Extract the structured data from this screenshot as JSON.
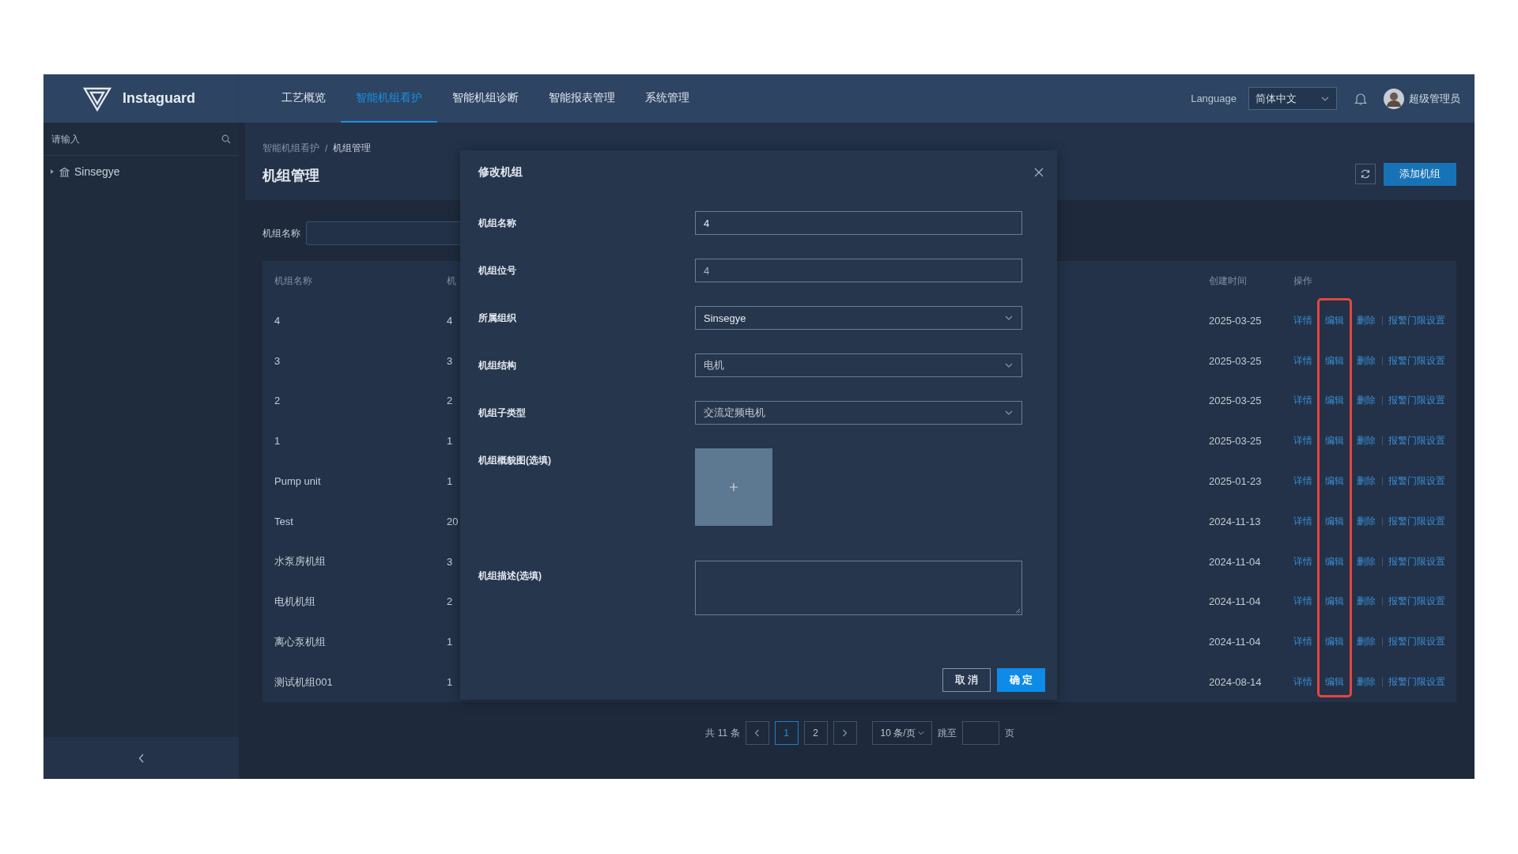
{
  "header": {
    "logo": "Instaguard",
    "nav": [
      {
        "label": "工艺概览",
        "selected": false
      },
      {
        "label": "智能机组看护",
        "selected": true
      },
      {
        "label": "智能机组诊断",
        "selected": false
      },
      {
        "label": "智能报表管理",
        "selected": false
      },
      {
        "label": "系统管理",
        "selected": false
      }
    ],
    "language_label": "Language",
    "language": "简体中文",
    "user": "超级管理员"
  },
  "sidebar": {
    "search_placeholder": "请输入",
    "tree": [
      {
        "label": "Sinsegye",
        "expanded": false
      }
    ]
  },
  "breadcrumb": [
    "智能机组看护",
    "机组管理"
  ],
  "breadcrumb_separator": "/",
  "page_title": "机组管理",
  "add_button": "添加机组",
  "filter": {
    "label": "机组名称"
  },
  "table": {
    "columns": [
      "机组名称",
      "机",
      "创建时间",
      "操作"
    ],
    "action_columns": [
      {
        "highlighted": false
      },
      {
        "highlighted": true
      },
      {
        "highlighted": false
      },
      {
        "highlighted": false
      }
    ],
    "rows": [
      {
        "cells": [
          "4",
          "4",
          "2025-03-25"
        ],
        "actions": [
          "详情",
          "编辑",
          "删除",
          "报警门限设置"
        ]
      },
      {
        "cells": [
          "3",
          "3",
          "2025-03-25"
        ],
        "actions": [
          "详情",
          "编辑",
          "删除",
          "报警门限设置"
        ]
      },
      {
        "cells": [
          "2",
          "2",
          "2025-03-25"
        ],
        "actions": [
          "详情",
          "编辑",
          "删除",
          "报警门限设置"
        ]
      },
      {
        "cells": [
          "1",
          "1",
          "2025-03-25"
        ],
        "actions": [
          "详情",
          "编辑",
          "删除",
          "报警门限设置"
        ]
      },
      {
        "cells": [
          "Pump unit",
          "1",
          "2025-01-23"
        ],
        "actions": [
          "详情",
          "编辑",
          "删除",
          "报警门限设置"
        ]
      },
      {
        "cells": [
          "Test",
          "20",
          "2024-11-13"
        ],
        "actions": [
          "详情",
          "编辑",
          "删除",
          "报警门限设置"
        ]
      },
      {
        "cells": [
          "水泵房机组",
          "3",
          "2024-11-04"
        ],
        "actions": [
          "详情",
          "编辑",
          "删除",
          "报警门限设置"
        ]
      },
      {
        "cells": [
          "电机机组",
          "2",
          "2024-11-04"
        ],
        "actions": [
          "详情",
          "编辑",
          "删除",
          "报警门限设置"
        ]
      },
      {
        "cells": [
          "离心泵机组",
          "1",
          "2024-11-04"
        ],
        "actions": [
          "详情",
          "编辑",
          "删除",
          "报警门限设置"
        ]
      },
      {
        "cells": [
          "测试机组001",
          "1",
          "2024-08-14"
        ],
        "actions": [
          "详情",
          "编辑",
          "删除",
          "报警门限设置"
        ]
      }
    ]
  },
  "pagination": {
    "total": "共 11 条",
    "pages": [
      {
        "label": "1",
        "selected": true
      },
      {
        "label": "2",
        "selected": false
      }
    ],
    "page_size": "10 条/页",
    "jump_label": "跳至",
    "page_suffix": "页"
  },
  "dialog": {
    "title": "修改机组",
    "fields": [
      {
        "kind": "text",
        "label": "机组名称",
        "value": "4",
        "disabled": false
      },
      {
        "kind": "text",
        "label": "机组位号",
        "value": "4",
        "disabled": true
      },
      {
        "kind": "select",
        "label": "所属组织",
        "value": "Sinsegye"
      },
      {
        "kind": "select",
        "label": "机组结构",
        "value": "电机"
      },
      {
        "kind": "select",
        "label": "机组子类型",
        "value": "交流定频电机"
      },
      {
        "kind": "upload",
        "label": "机组概貌图(选填)"
      },
      {
        "kind": "textarea",
        "label": "机组描述(选填)"
      }
    ],
    "buttons": [
      {
        "label": "取 消",
        "primary": false
      },
      {
        "label": "确 定",
        "primary": true
      }
    ]
  }
}
